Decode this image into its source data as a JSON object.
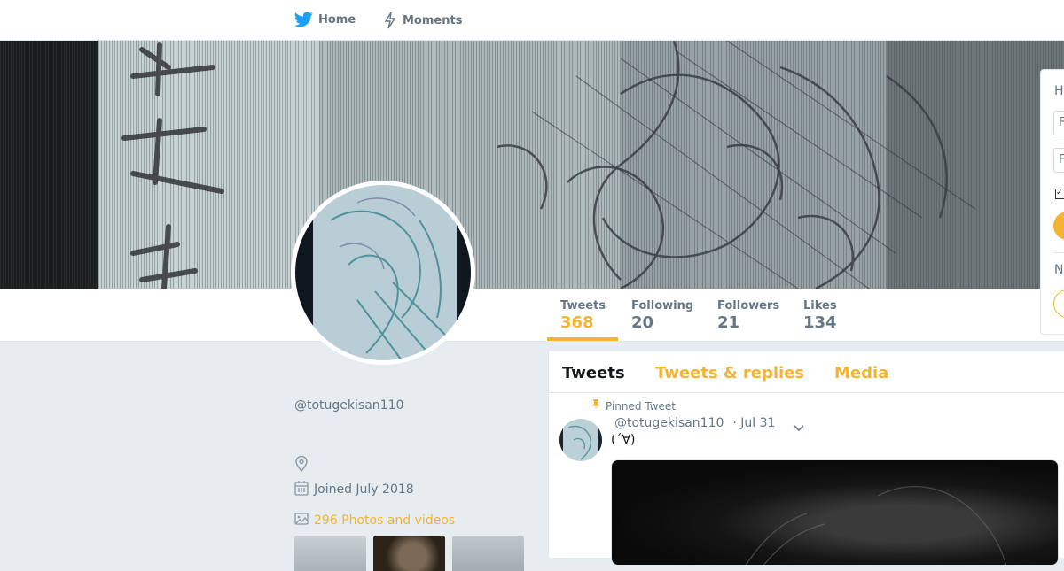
{
  "nav": {
    "home_label": "Home",
    "moments_label": "Moments"
  },
  "stats": {
    "tweets": {
      "label": "Tweets",
      "value": "368"
    },
    "following": {
      "label": "Following",
      "value": "20"
    },
    "followers": {
      "label": "Followers",
      "value": "21"
    },
    "likes": {
      "label": "Likes",
      "value": "134"
    }
  },
  "profile": {
    "name": "󠀠󠀠",
    "handle": "@totugekisan110",
    "joined": "Joined July 2018",
    "photos_link": "296 Photos and videos"
  },
  "timeline": {
    "tabs": [
      "Tweets",
      "Tweets & replies",
      "Media"
    ],
    "pinned_label": "Pinned Tweet",
    "tweet": {
      "handle": "@totugekisan110",
      "date": "· Jul 31",
      "text": "(´∀)"
    }
  },
  "login_card": {
    "heading_initial": "H",
    "field1_initial": "F",
    "field2_initial": "F",
    "section_initial": "N"
  },
  "colors": {
    "accent": "#f5b331",
    "twitter_blue": "#1da1f2",
    "muted": "#657786",
    "background": "#e6ecf0"
  },
  "icons": [
    "twitter-bird-icon",
    "moments-bolt-icon",
    "location-pin-icon",
    "calendar-icon",
    "photo-icon",
    "pin-icon",
    "chevron-down-icon"
  ]
}
